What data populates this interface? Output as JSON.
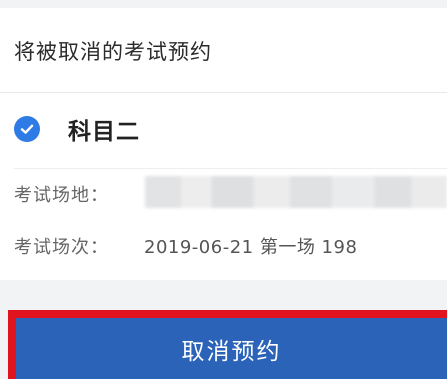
{
  "section_title": "将被取消的考试预约",
  "subject": {
    "label": "科目二",
    "selected": true,
    "icon": "check-circle-icon",
    "accent_color": "#2f7be6"
  },
  "details": {
    "venue_label": "考试场地：",
    "venue_value": "",
    "session_label": "考试场次：",
    "session_value": "2019-06-21 第一场 198"
  },
  "actions": {
    "cancel_label": "取消预约",
    "button_color": "#2b63b8",
    "highlight_color": "#e0141e"
  }
}
